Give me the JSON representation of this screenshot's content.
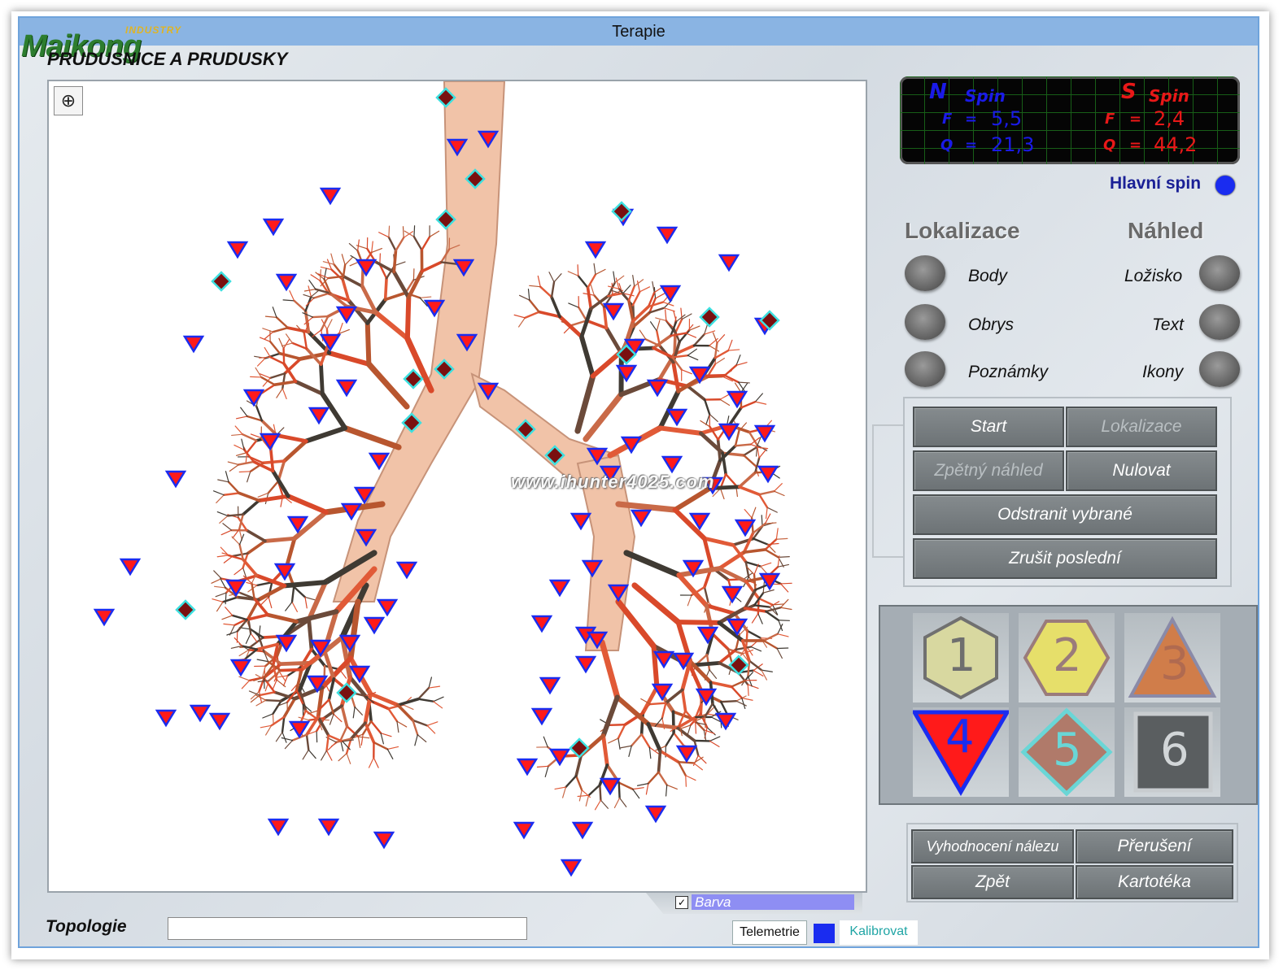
{
  "window": {
    "title": "Terapie"
  },
  "logo": {
    "brand": "Maikong",
    "sub": "INDUSTRY"
  },
  "organ": {
    "title": "PRUDUSNICE A PRUDUSKY"
  },
  "watermark": "www.ihunter4025.com",
  "spin": {
    "north": {
      "pole": "N",
      "label": "Spin",
      "f_label": "F",
      "q_label": "Q",
      "eq": "=",
      "f": "5,5",
      "q": "21,3"
    },
    "south": {
      "pole": "S",
      "label": "Spin",
      "f_label": "F",
      "q_label": "Q",
      "eq": "=",
      "f": "2,4",
      "q": "44,2"
    },
    "main_spin_label": "Hlavní spin",
    "main_spin_color": "#1a2cf0"
  },
  "lokalizace": {
    "title": "Lokalizace",
    "items": [
      "Body",
      "Obrys",
      "Poznámky"
    ]
  },
  "nahled": {
    "title": "Náhled",
    "items": [
      "Ložisko",
      "Text",
      "Ikony"
    ]
  },
  "actions": {
    "start": "Start",
    "lokalizace": "Lokalizace",
    "zpetny": "Zpětný náhled",
    "nulovat": "Nulovat",
    "odstranit": "Odstranit vybrané",
    "zrusit": "Zrušit poslední"
  },
  "symbols": [
    {
      "n": "1",
      "shape": "hexagon",
      "fill": "#d8d8a0",
      "stroke": "#707070"
    },
    {
      "n": "2",
      "shape": "hexagon-flat",
      "fill": "#e6df6a",
      "stroke": "#9a7b7b"
    },
    {
      "n": "3",
      "shape": "triangle",
      "fill": "#d07d4a",
      "stroke": "#8a8aa8"
    },
    {
      "n": "4",
      "shape": "triangle-down",
      "fill": "#ff1a1a",
      "stroke": "#1a2cf0",
      "selected": true
    },
    {
      "n": "5",
      "shape": "diamond",
      "fill": "#b07a6a",
      "stroke": "#6ad6d6"
    },
    {
      "n": "6",
      "shape": "square",
      "fill": "#5a5e60",
      "stroke": "#c8cccf"
    }
  ],
  "bottom": {
    "vyhodnoceni": "Vyhodnocení nálezu",
    "preruseni": "Přerušení",
    "zpet": "Zpět",
    "kartoteka": "Kartotéka"
  },
  "barva": {
    "checked": true,
    "label": "Barva"
  },
  "topologie": {
    "label": "Topologie",
    "value": ""
  },
  "telemetrie": "Telemetrie",
  "kalibrovat": "Kalibrovat",
  "colors": {
    "titlebar": "#8ab4e3",
    "marker_fill": "#ff1a1a",
    "marker_stroke": "#1a2cf0",
    "diamond_fill": "#7a1010",
    "diamond_stroke": "#3de0e0"
  }
}
